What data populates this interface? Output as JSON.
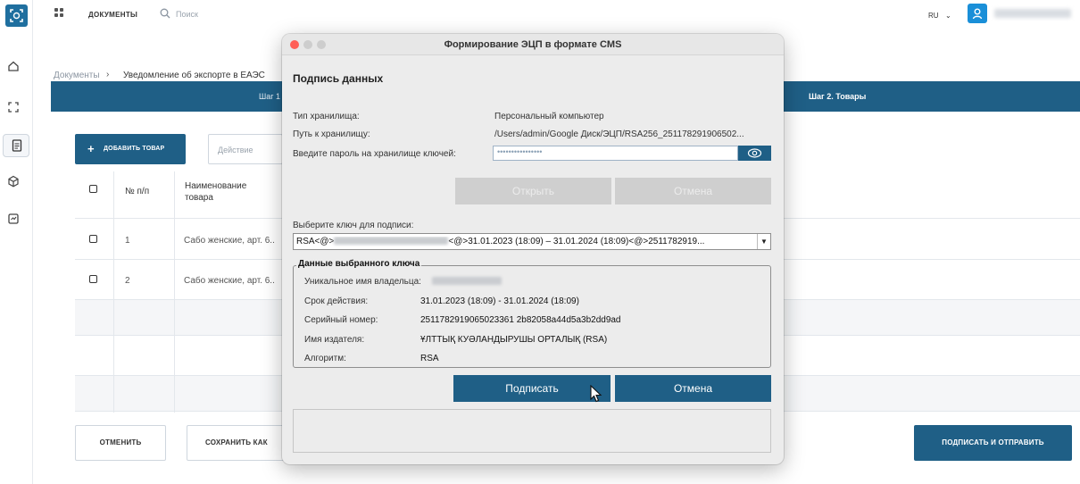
{
  "topbar": {
    "nav_documents": "ДОКУМЕНТЫ",
    "search_placeholder": "Поиск",
    "language": "RU",
    "language_chevron": "⌄"
  },
  "breadcrumb": {
    "root": "Документы",
    "separator": "›",
    "current": "Уведомление об экспорте в ЕАЭС"
  },
  "steps": {
    "step1_label": "Шаг 1",
    "step2_label": "Шаг 2. Товары"
  },
  "toolbar": {
    "add_button": "ДОБАВИТЬ ТОВАР",
    "action_placeholder": "Действие"
  },
  "table": {
    "columns": [
      "№ п/п",
      "Наименование товара"
    ],
    "rows": [
      {
        "num": "1",
        "name": "Сабо женские, арт. 6.."
      },
      {
        "num": "2",
        "name": "Сабо женские, арт. 6.."
      }
    ]
  },
  "footer": {
    "cancel": "ОТМЕНИТЬ",
    "save_as": "СОХРАНИТЬ КАК",
    "sign_send": "ПОДПИСАТЬ И ОТПРАВИТЬ"
  },
  "modal": {
    "title": "Формирование ЭЦП в формате CMS",
    "heading": "Подпись данных",
    "storage_type_label": "Тип хранилища:",
    "storage_type_value": "Персональный компьютер",
    "storage_path_label": "Путь к хранилищу:",
    "storage_path_value": "/Users/admin/Google Диск/ЭЦП/RSA256_251178291906502...",
    "password_label": "Введите пароль на хранилище ключей:",
    "password_mask": "••••••••••••••••",
    "open_button": "Открыть",
    "cancel_top_button": "Отмена",
    "select_key_label": "Выберите ключ для подписи:",
    "key_prefix": "RSA<@>",
    "key_suffix": "<@>31.01.2023 (18:09) – 31.01.2024 (18:09)<@>2511782919...",
    "key_arrow": "▼",
    "key_info": {
      "legend": "Данные выбранного ключа",
      "owner_label": "Уникальное имя владельца:",
      "validity_label": "Срок действия:",
      "validity_value": "31.01.2023 (18:09) - 31.01.2024 (18:09)",
      "serial_label": "Серийный номер:",
      "serial_value": "2511782919065023361 2b82058a44d5a3b2dd9ad",
      "issuer_label": "Имя издателя:",
      "issuer_value": "ҰЛТТЫҚ КУӘЛАНДЫРУШЫ ОРТАЛЫҚ (RSA)",
      "algorithm_label": "Алгоритм:",
      "algorithm_value": "RSA"
    },
    "sign_button": "Подписать",
    "cancel_bottom_button": "Отмена"
  },
  "colors": {
    "primary": "#1f5f86",
    "accent": "#1a8fd8",
    "traffic_close": "#ff5f57",
    "traffic_disabled": "#cdcdcd"
  }
}
